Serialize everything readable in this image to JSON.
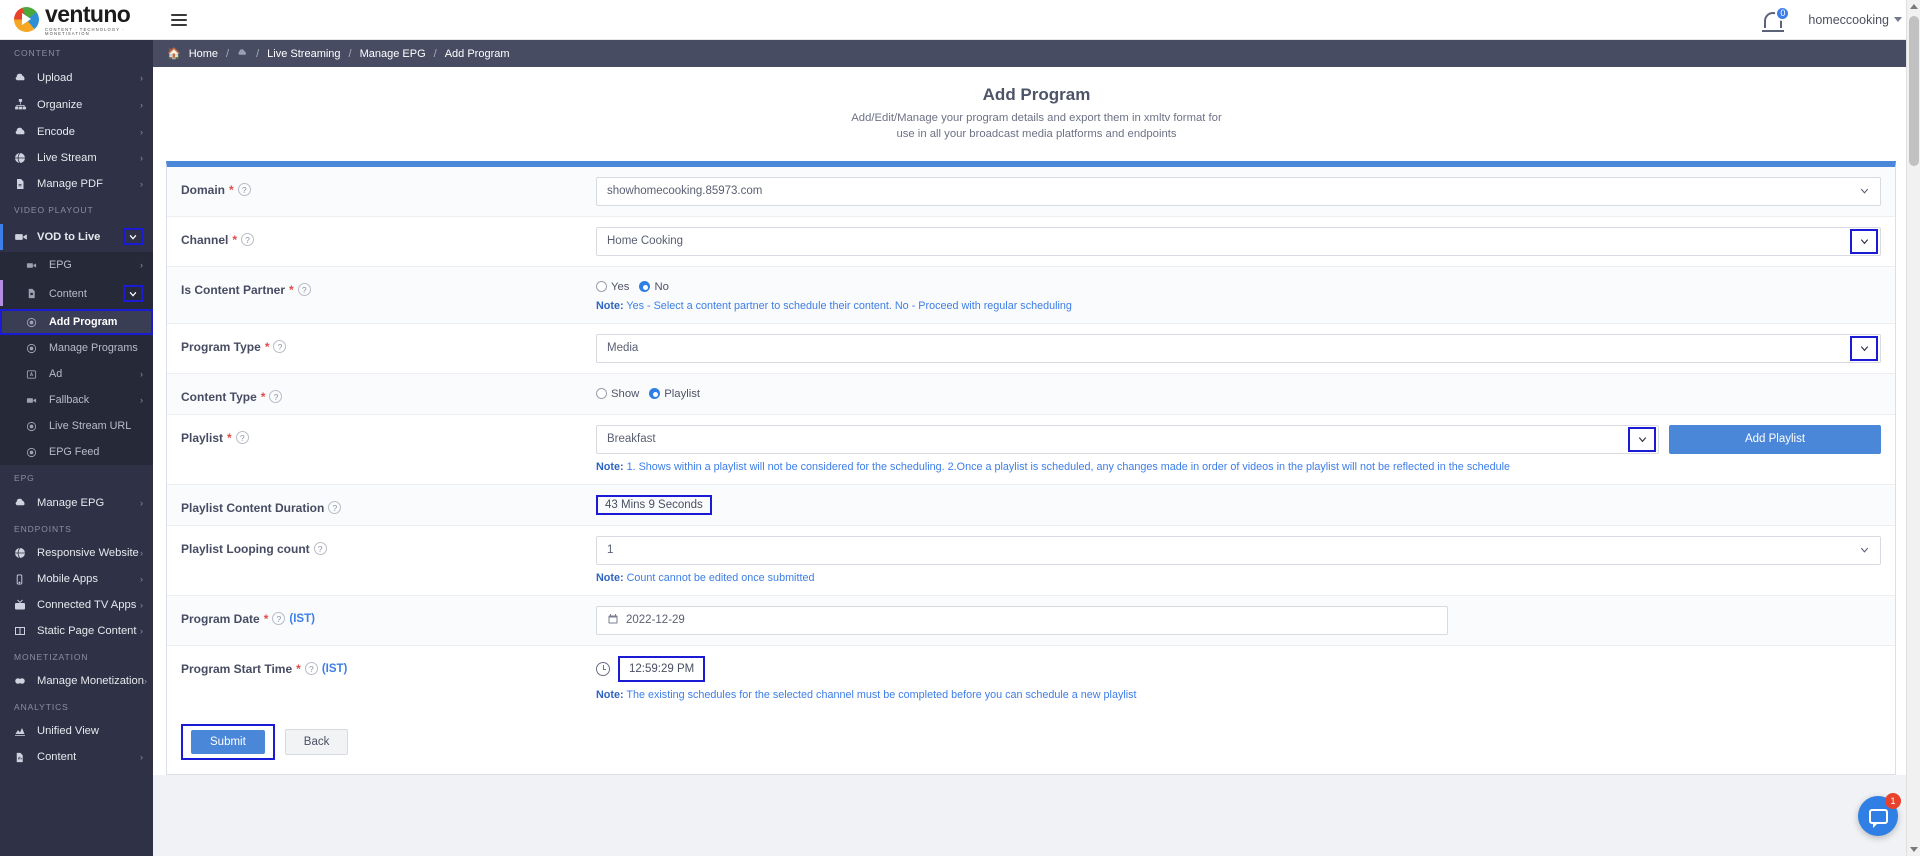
{
  "topbar": {
    "brand": "ventuno",
    "brand_tagline": "CONTENT  ·  TECHNOLOGY  ·  MONETISATION",
    "notification_count": "0",
    "user_name": "homeccooking"
  },
  "sidebar": {
    "sections": [
      {
        "title": "CONTENT",
        "items": [
          {
            "label": "Upload",
            "icon": "cloud-upload-icon",
            "arrow": "›"
          },
          {
            "label": "Organize",
            "icon": "sitemap-icon",
            "arrow": "›"
          },
          {
            "label": "Encode",
            "icon": "cloud-icon",
            "arrow": "›"
          },
          {
            "label": "Live Stream",
            "icon": "globe-icon",
            "arrow": "›"
          },
          {
            "label": "Manage PDF",
            "icon": "file-pdf-icon",
            "arrow": "›"
          }
        ]
      },
      {
        "title": "VIDEO PLAYOUT",
        "items": [
          {
            "label": "VOD to Live",
            "icon": "video-camera-icon",
            "arrow": ""
          }
        ],
        "sub_items": [
          {
            "label": "EPG",
            "icon": "video-icon",
            "arrow": "›"
          },
          {
            "label": "Content",
            "icon": "file-video-icon",
            "arrow": ""
          },
          {
            "label": "Add Program",
            "icon": "circle-dot-icon",
            "arrow": ""
          },
          {
            "label": "Manage Programs",
            "icon": "circle-dot-icon",
            "arrow": ""
          },
          {
            "label": "Ad",
            "icon": "ad-icon",
            "arrow": "›"
          },
          {
            "label": "Fallback",
            "icon": "video-icon",
            "arrow": "›"
          },
          {
            "label": "Live Stream URL",
            "icon": "circle-dot-icon",
            "arrow": ""
          },
          {
            "label": "EPG Feed",
            "icon": "circle-dot-icon",
            "arrow": ""
          }
        ]
      },
      {
        "title": "EPG",
        "items": [
          {
            "label": "Manage EPG",
            "icon": "cloud-icon",
            "arrow": "›"
          }
        ]
      },
      {
        "title": "ENDPOINTS",
        "items": [
          {
            "label": "Responsive Website",
            "icon": "globe-icon",
            "arrow": "›"
          },
          {
            "label": "Mobile Apps",
            "icon": "mobile-icon",
            "arrow": "›"
          },
          {
            "label": "Connected TV Apps",
            "icon": "tv-icon",
            "arrow": "›"
          },
          {
            "label": "Static Page Content",
            "icon": "columns-icon",
            "arrow": "›"
          }
        ]
      },
      {
        "title": "MONETIZATION",
        "items": [
          {
            "label": "Manage Monetization",
            "icon": "money-icon",
            "arrow": "›"
          }
        ]
      },
      {
        "title": "ANALYTICS",
        "items": [
          {
            "label": "Unified View",
            "icon": "chart-icon",
            "arrow": ""
          },
          {
            "label": "Content",
            "icon": "file-chart-icon",
            "arrow": "›"
          }
        ]
      }
    ]
  },
  "breadcrumb": {
    "home": "Home",
    "sep": "/",
    "cloud_icon": "cloud-icon",
    "items": [
      "Live Streaming",
      "Manage EPG",
      "Add Program"
    ]
  },
  "page": {
    "title": "Add Program",
    "subtitle_line1": "Add/Edit/Manage your program details and export them in xmltv format for",
    "subtitle_line2": "use in all your broadcast media platforms and endpoints"
  },
  "form": {
    "domain": {
      "label": "Domain",
      "required": "*",
      "help": "?",
      "value": "showhomecooking.85973.com"
    },
    "channel": {
      "label": "Channel",
      "required": "*",
      "help": "?",
      "value": "Home Cooking"
    },
    "is_content_partner": {
      "label": "Is Content Partner",
      "required": "*",
      "help": "?",
      "options": [
        "Yes",
        "No"
      ],
      "selected": "No",
      "note_prefix": "Note:",
      "note": " Yes - Select a content partner to schedule their content. No - Proceed with regular scheduling"
    },
    "program_type": {
      "label": "Program Type",
      "required": "*",
      "help": "?",
      "value": "Media"
    },
    "content_type": {
      "label": "Content Type",
      "required": "*",
      "help": "?",
      "options": [
        "Show",
        "Playlist"
      ],
      "selected": "Playlist"
    },
    "playlist": {
      "label": "Playlist",
      "required": "*",
      "help": "?",
      "value": "Breakfast",
      "add_button": "Add Playlist",
      "note_prefix": "Note:",
      "note": " 1. Shows within a playlist will not be considered for the scheduling. 2.Once a playlist is scheduled, any changes made in order of videos in the playlist will not be reflected in the schedule"
    },
    "playlist_duration": {
      "label": "Playlist Content Duration",
      "help": "?",
      "value": "43 Mins 9 Seconds"
    },
    "looping_count": {
      "label": "Playlist Looping count",
      "help": "?",
      "value": "1",
      "note_prefix": "Note:",
      "note": " Count cannot be edited once submitted"
    },
    "program_date": {
      "label": "Program Date",
      "required": "*",
      "help": "?",
      "timezone": "(IST)",
      "value": "2022-12-29",
      "icon": "calendar-icon"
    },
    "program_start_time": {
      "label": "Program Start Time",
      "required": "*",
      "help": "?",
      "timezone": "(IST)",
      "value": "12:59:29 PM",
      "icon": "clock-icon",
      "note_prefix": "Note:",
      "note": " The existing schedules for the selected channel must be completed before you can schedule a new playlist"
    },
    "buttons": {
      "submit": "Submit",
      "back": "Back"
    }
  },
  "chat": {
    "unread": "1",
    "icon": "chat-bubble-icon"
  },
  "colors": {
    "accent": "#4a87d8",
    "sidebar": "#2f3246",
    "highlight": "#1b1bd6",
    "note": "#3d7ee8",
    "required": "#e14b4b"
  }
}
